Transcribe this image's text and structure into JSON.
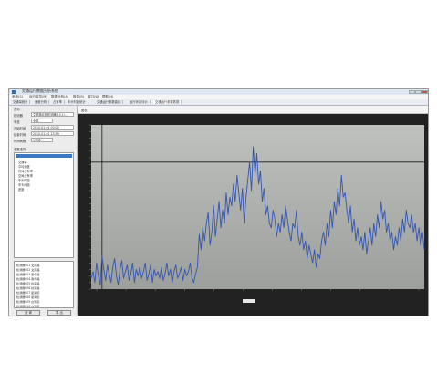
{
  "colors": {
    "plot_background_top": "#bfc1bf",
    "plot_background_bottom": "#9c9f9c",
    "chart_frame": "#222222",
    "series_line": "#3355b0",
    "threshold_line": "#1a1a1a",
    "selection_highlight": "#3a78c2"
  },
  "chart_data": {
    "type": "line",
    "ylim": [
      0,
      75
    ],
    "y_ticks": [
      0,
      3,
      6,
      9,
      12,
      15,
      18,
      21,
      24,
      27,
      30,
      33,
      36,
      39,
      42,
      45,
      48,
      51,
      54,
      57,
      60,
      63,
      66,
      69,
      72,
      75
    ],
    "threshold": 58,
    "vertical_marker_index": 6,
    "grid": false,
    "x_tick_count": 12,
    "series": [
      {
        "values": [
          5,
          8,
          3,
          12,
          6,
          2,
          15,
          9,
          4,
          11,
          7,
          3,
          10,
          14,
          6,
          2,
          9,
          13,
          5,
          8,
          11,
          4,
          7,
          12,
          3,
          9,
          6,
          10,
          5,
          8,
          12,
          4,
          7,
          11,
          3,
          9,
          6,
          8,
          5,
          10,
          4,
          7,
          12,
          6,
          9,
          3,
          8,
          11,
          5,
          7,
          10,
          4,
          9,
          6,
          8,
          12,
          5,
          3,
          7,
          10,
          25,
          18,
          28,
          22,
          30,
          35,
          20,
          26,
          38,
          24,
          32,
          40,
          28,
          36,
          30,
          44,
          34,
          42,
          38,
          48,
          40,
          52,
          44,
          36,
          46,
          30,
          42,
          50,
          58,
          45,
          65,
          52,
          62,
          48,
          54,
          40,
          46,
          34,
          38,
          30,
          28,
          36,
          32,
          24,
          30,
          26,
          34,
          28,
          38,
          32,
          26,
          22,
          30,
          28,
          36,
          24,
          20,
          26,
          18,
          22,
          14,
          20,
          16,
          12,
          18,
          10,
          16,
          14,
          22,
          26,
          20,
          30,
          24,
          36,
          28,
          40,
          34,
          46,
          38,
          52,
          42,
          44,
          36,
          30,
          38,
          26,
          32,
          22,
          28,
          20,
          24,
          18,
          26,
          16,
          22,
          28,
          20,
          30,
          24,
          34,
          28,
          40,
          32,
          36,
          26,
          30,
          22,
          26,
          18,
          24,
          20,
          28,
          22,
          32,
          26,
          36,
          30,
          28,
          34,
          26,
          30,
          22,
          28,
          20,
          26,
          18
        ]
      }
    ]
  },
  "window": {
    "title": "交通运行数据分析系统",
    "menu": [
      "系统(S)",
      "运行监控(M)",
      "数据分析(A)",
      "报表(R)",
      "窗口(W)",
      "帮助(H)"
    ],
    "tabs": [
      "交通量统计",
      "速度分析",
      "占有率",
      "车头时距统计",
      "交通运行参数曲线",
      "运行状态评价",
      "交通运行参数数据"
    ],
    "active_tab": 6
  },
  "left_panel": {
    "header": "查询",
    "fields": [
      {
        "label": "检测器",
        "value": "文苑路北段检测器(10,1)..."
      },
      {
        "label": "车道",
        "value": "全部"
      },
      {
        "label": "开始时间",
        "value": "2010-01-01  00:00"
      },
      {
        "label": "结束时间",
        "value": "2010-01-01  23:59"
      },
      {
        "label": "时间间隔",
        "value": "1分钟"
      }
    ],
    "tree_title": "参数选择",
    "tree_items": [
      "交通量",
      "平均速度",
      "时间占有率",
      "空间占有率",
      "车头时距",
      "车头间距",
      "密度"
    ],
    "list_items": [
      "检测器001 文苑路",
      "检测器002 文苑路",
      "检测器003 春华路",
      "检测器004 春华路",
      "检测器005 秋实路",
      "检测器006 秋实路",
      "检测器007 星湖街",
      "检测器008 星湖街",
      "检测器009 白鹭街",
      "检测器010 白鹭街"
    ],
    "query_button": "查 询",
    "export_button": "导 出"
  },
  "chart_panel": {
    "header": "图表"
  }
}
